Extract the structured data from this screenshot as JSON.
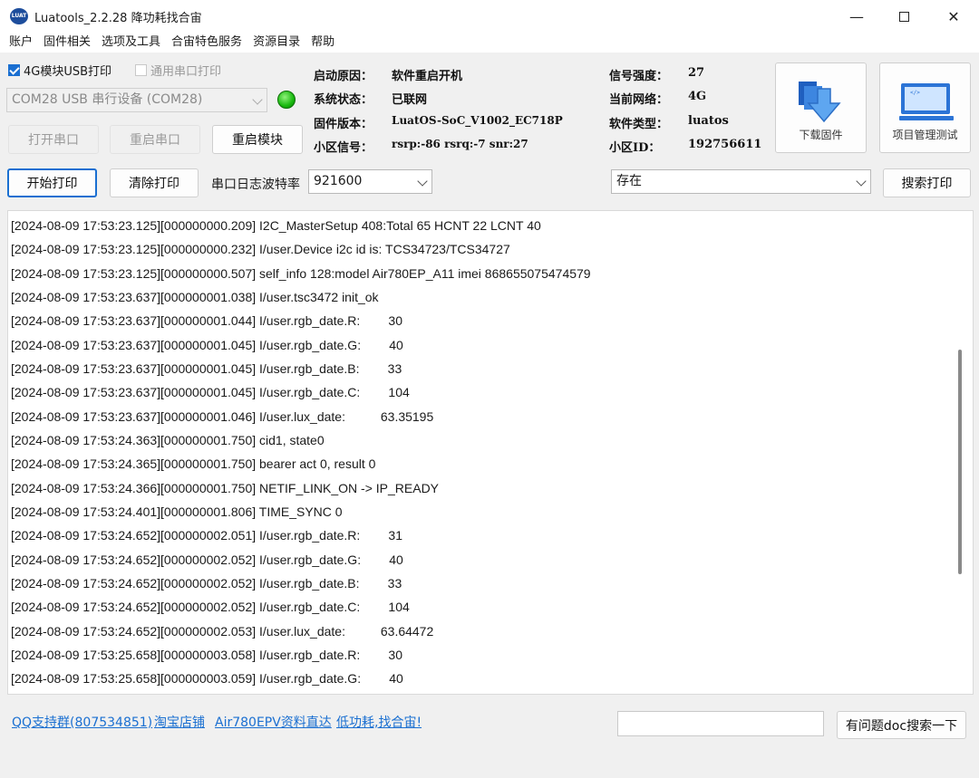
{
  "window": {
    "title": "Luatools_2.2.28 降功耗找合宙",
    "icon": "LUAT",
    "minimize_icon": "minimize-icon",
    "maximize_icon": "maximize-icon",
    "close_icon": "close-icon"
  },
  "menu": [
    "账户",
    "固件相关",
    "选项及工具",
    "合宙特色服务",
    "资源目录",
    "帮助"
  ],
  "options": {
    "usb4g_label": "4G模块USB打印",
    "usb4g_checked": true,
    "serial_label": "通用串口打印",
    "serial_checked": false
  },
  "port": {
    "selected": "COM28 USB 串行设备 (COM28)",
    "status_color": "#17b80e"
  },
  "buttons": {
    "open_port": "打开串口",
    "close_port": "重启串口",
    "restart_module": "重启模块",
    "start_print": "开始打印",
    "clear_print": "清除打印",
    "search_print": "搜索打印",
    "download_fw": "下载固件",
    "project_test": "项目管理测试",
    "doc_search": "有问题doc搜索一下"
  },
  "device": {
    "start_reason_label": "启动原因：",
    "start_reason": "软件重启开机",
    "sys_state_label": "系统状态：",
    "sys_state": "已联网",
    "fw_version_label": "固件版本：",
    "fw_version": "LuatOS-SoC_V1002_EC718P",
    "cell_signal_label": "小区信号：",
    "cell_signal": "rsrp:-86 rsrq:-7 snr:27",
    "signal_strength_label": "信号强度：",
    "signal_strength": "27",
    "network_label": "当前网络：",
    "network": "4G",
    "sw_type_label": "软件类型：",
    "sw_type": "luatos",
    "cell_id_label": "小区ID：",
    "cell_id": "192756611"
  },
  "baud": {
    "label": "串口日志波特率",
    "value": "921600"
  },
  "filter": {
    "value": "存在"
  },
  "log": [
    "[2024-08-09 17:53:23.125][000000000.209] I2C_MasterSetup 408:Total 65 HCNT 22 LCNT 40",
    "[2024-08-09 17:53:23.125][000000000.232] I/user.Device i2c id is: TCS34723/TCS34727",
    "[2024-08-09 17:53:23.125][000000000.507] self_info 128:model Air780EP_A11 imei 868655075474579",
    "[2024-08-09 17:53:23.637][000000001.038] I/user.tsc3472 init_ok",
    "[2024-08-09 17:53:23.637][000000001.044] I/user.rgb_date.R:        30",
    "[2024-08-09 17:53:23.637][000000001.045] I/user.rgb_date.G:        40",
    "[2024-08-09 17:53:23.637][000000001.045] I/user.rgb_date.B:        33",
    "[2024-08-09 17:53:23.637][000000001.045] I/user.rgb_date.C:        104",
    "[2024-08-09 17:53:23.637][000000001.046] I/user.lux_date:          63.35195",
    "[2024-08-09 17:53:24.363][000000001.750] cid1, state0",
    "[2024-08-09 17:53:24.365][000000001.750] bearer act 0, result 0",
    "[2024-08-09 17:53:24.366][000000001.750] NETIF_LINK_ON -> IP_READY",
    "[2024-08-09 17:53:24.401][000000001.806] TIME_SYNC 0",
    "[2024-08-09 17:53:24.652][000000002.051] I/user.rgb_date.R:        31",
    "[2024-08-09 17:53:24.652][000000002.052] I/user.rgb_date.G:        40",
    "[2024-08-09 17:53:24.652][000000002.052] I/user.rgb_date.B:        33",
    "[2024-08-09 17:53:24.652][000000002.052] I/user.rgb_date.C:        104",
    "[2024-08-09 17:53:24.652][000000002.053] I/user.lux_date:          63.64472",
    "[2024-08-09 17:53:25.658][000000003.058] I/user.rgb_date.R:        30",
    "[2024-08-09 17:53:25.658][000000003.059] I/user.rgb_date.G:        40"
  ],
  "footer": {
    "links": [
      "QQ支持群(807534851)",
      "淘宝店铺",
      "Air780EPV资料直达",
      "低功耗,找合宙!"
    ],
    "search_value": ""
  },
  "colors": {
    "accent": "#1a6fd1",
    "link": "#1a6fd1"
  }
}
